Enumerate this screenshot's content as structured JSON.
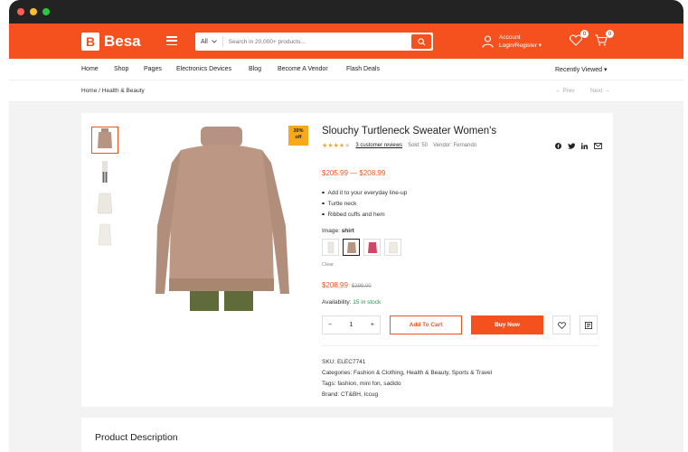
{
  "header": {
    "logo_letter": "B",
    "logo_text": "Besa",
    "search": {
      "category": "All",
      "placeholder": "Search in 20,000+ products..."
    },
    "account": {
      "line1": "Account",
      "line2": "Login/Register"
    },
    "wishlist_count": "0",
    "cart_count": "0",
    "brand_color": "#f5511e"
  },
  "nav": {
    "items": [
      "Home",
      "Shop",
      "Pages",
      "Electronics Devices",
      "Blog",
      "Become A Vendor",
      "Flash Deals"
    ],
    "recently_viewed": "Recently Viewed"
  },
  "breadcrumb": {
    "home": "Home",
    "category": "Health & Beauty",
    "prev": "Prev",
    "next": "Next"
  },
  "product": {
    "sale_badge_1": "30%",
    "sale_badge_2": "off",
    "title": "Slouchy Turtleneck Sweater Women's",
    "rating": 4,
    "reviews": "3 customer reviews",
    "sold": "Sold: 50",
    "vendor": "Vendor: Fernando",
    "price_range_low": "$205.99",
    "price_range_sep": "—",
    "price_range_high": "$208.99",
    "bullets": [
      "Add it to your everyday line-up",
      "Turtle neck",
      "Ribbed cuffs and hem"
    ],
    "image_label": "Image:",
    "image_value": "shirt",
    "clear": "Clear",
    "price_now": "$208.99",
    "price_old": "$299.00",
    "availability_label": "Availability:",
    "availability_value": "15 in stock",
    "qty": "1",
    "add_to_cart": "Add To Cart",
    "buy_now": "Buy Now",
    "sku": "SKU: ELEC7741",
    "categories": "Categories:  Fashion & Clothing, Health & Beauty, Sports & Travel",
    "tags": "Tags:  fashion, mini fon, sadido",
    "brand": "Brand:  CT&BH,  Iccug"
  },
  "description": {
    "title": "Product Description"
  }
}
